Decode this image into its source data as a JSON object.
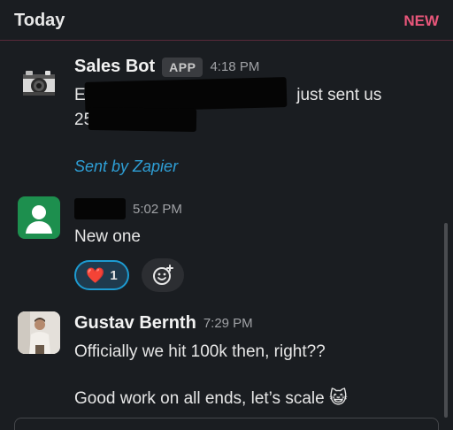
{
  "header": {
    "day": "Today",
    "new_label": "NEW"
  },
  "messages": [
    {
      "sender": "Sales Bot",
      "badge": "APP",
      "time": "4:18 PM",
      "line1_prefix": "E",
      "line1_suffix": "just sent us",
      "line2_prefix": "25",
      "footer": "Sent by Zapier",
      "avatar_icon": "camera-icon"
    },
    {
      "sender": "",
      "time": "5:02 PM",
      "text": "New one",
      "avatar_icon": "person-icon",
      "reaction": {
        "emoji": "❤️",
        "count": "1"
      },
      "add_reaction_icon": "add-emoji-icon"
    },
    {
      "sender": "Gustav Bernth",
      "time": "7:29 PM",
      "line1": "Officially we hit 100k then, right??",
      "line2": "Good work on all ends, let’s scale",
      "trailing_emoji": "😺"
    }
  ],
  "colors": {
    "background": "#1a1d21",
    "new_accent": "#e8567a",
    "link": "#2e9fd6",
    "reaction_border": "#1d9bd1",
    "avatar_green": "#1d8f4e"
  }
}
